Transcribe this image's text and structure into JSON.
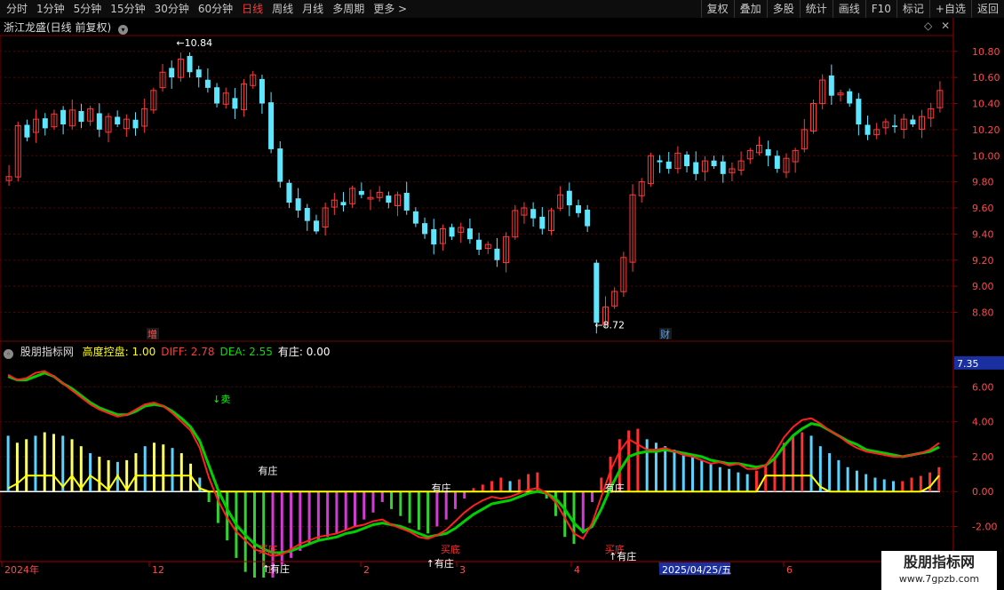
{
  "toolbar": {
    "periods": [
      "分时",
      "1分钟",
      "5分钟",
      "15分钟",
      "30分钟",
      "60分钟",
      "日线",
      "周线",
      "月线",
      "多周期",
      "更多 >"
    ],
    "active_period": "日线",
    "buttons": [
      "复权",
      "叠加",
      "多股",
      "统计",
      "画线",
      "F10",
      "标记",
      "+自选",
      "返回"
    ]
  },
  "main_chart": {
    "title": "浙江龙盛(日线 前复权)",
    "y_ticks": [
      "10.80",
      "10.60",
      "10.40",
      "10.20",
      "10.00",
      "9.80",
      "9.60",
      "9.40",
      "9.20",
      "9.00",
      "8.80"
    ],
    "y_range": [
      8.64,
      10.88
    ],
    "high_label": "10.84",
    "low_label": "8.72",
    "event_marks": [
      {
        "text": "增",
        "color": "#ff5555"
      },
      {
        "text": "财",
        "color": "#4da3ff"
      }
    ],
    "colors": {
      "up": "#ff3b3b",
      "down": "#5ee6ff",
      "grid": "#5a0000"
    }
  },
  "indicator": {
    "name": "股朋指标网",
    "legend": [
      {
        "label": "高度控盘: 1.00",
        "color": "#ffff00"
      },
      {
        "label": "DIFF: 2.78",
        "color": "#ff3b3b"
      },
      {
        "label": "DEA: 2.55",
        "color": "#00e000"
      },
      {
        "label": "有庄: 0.00",
        "color": "#ffffff"
      }
    ],
    "y_ticks": [
      "6.00",
      "4.00",
      "2.00",
      "0.00",
      "-2.00"
    ],
    "current_value": "7.35",
    "y_range": [
      -3.4,
      7.6
    ],
    "annotations": {
      "sell": "↓卖",
      "buy_bottom": "买底",
      "zhuang": "有庄",
      "zhuang_up": "↑有庄"
    }
  },
  "time_axis": {
    "labels": [
      "2024年",
      "12",
      "1",
      "2",
      "3",
      "4",
      "2025/04/25/五",
      "6"
    ],
    "highlight": "2025/04/25/五"
  },
  "watermark": {
    "line1": "股朋指标网",
    "line2": "www.7gpzb.com"
  },
  "chart_data": {
    "type": "candlestick",
    "title": "浙江龙盛(日线 前复权)",
    "ylim": [
      8.64,
      10.88
    ],
    "price_path": [
      9.84,
      10.23,
      10.14,
      10.28,
      10.21,
      10.32,
      10.24,
      10.35,
      10.26,
      10.36,
      10.2,
      10.3,
      10.24,
      10.28,
      10.21,
      10.36,
      10.5,
      10.64,
      10.6,
      10.74,
      10.64,
      10.6,
      10.52,
      10.4,
      10.48,
      10.36,
      10.55,
      10.62,
      10.4,
      10.05,
      9.8,
      9.64,
      9.58,
      9.5,
      9.42,
      9.6,
      9.66,
      9.62,
      9.75,
      9.7,
      9.68,
      9.72,
      9.64,
      9.7,
      9.58,
      9.48,
      9.4,
      9.32,
      9.44,
      9.38,
      9.45,
      9.36,
      9.28,
      9.32,
      9.2,
      9.38,
      9.58,
      9.6,
      9.52,
      9.44,
      9.58,
      9.7,
      9.62,
      9.56,
      9.46,
      8.72,
      8.84,
      8.96,
      9.22,
      9.7,
      9.8,
      10.0,
      9.95,
      9.9,
      10.02,
      9.92,
      9.86,
      9.96,
      9.92,
      9.86,
      9.9,
      9.96,
      10.04,
      10.08,
      10.0,
      9.9,
      9.98,
      10.04,
      10.2,
      10.4,
      10.58,
      10.46,
      10.48,
      10.4,
      10.24,
      10.16,
      10.2,
      10.26,
      10.22,
      10.28,
      10.24,
      10.3,
      10.36,
      10.5
    ],
    "high": 10.84,
    "low": 8.72,
    "indicator": {
      "diff": [
        6.7,
        6.4,
        6.5,
        6.8,
        6.9,
        6.6,
        6.2,
        5.8,
        5.4,
        5.0,
        4.7,
        4.5,
        4.3,
        4.4,
        4.7,
        5.0,
        5.1,
        4.9,
        4.5,
        4.0,
        3.5,
        2.5,
        0.8,
        -0.5,
        -1.5,
        -2.3,
        -2.8,
        -3.3,
        -3.5,
        -3.7,
        -3.6,
        -3.3,
        -3.0,
        -2.8,
        -2.6,
        -2.5,
        -2.4,
        -2.2,
        -2.0,
        -1.9,
        -1.7,
        -1.6,
        -1.9,
        -2.1,
        -2.3,
        -2.6,
        -2.7,
        -2.5,
        -2.2,
        -1.7,
        -1.2,
        -0.8,
        -0.5,
        -0.3,
        -0.4,
        -0.3,
        -0.1,
        0.1,
        0.2,
        -0.1,
        -0.6,
        -1.5,
        -2.4,
        -2.7,
        -1.8,
        -0.3,
        1.2,
        2.3,
        3.0,
        2.7,
        2.4,
        2.4,
        2.5,
        2.3,
        2.1,
        2.0,
        1.8,
        1.6,
        1.7,
        1.5,
        1.6,
        1.3,
        1.3,
        1.5,
        2.2,
        3.1,
        3.7,
        4.1,
        4.2,
        3.9,
        3.5,
        3.2,
        2.8,
        2.5,
        2.3,
        2.2,
        2.1,
        2.0,
        2.0,
        2.1,
        2.2,
        2.4,
        2.78
      ],
      "dea": [
        6.6,
        6.4,
        6.4,
        6.6,
        6.8,
        6.6,
        6.2,
        5.9,
        5.5,
        5.1,
        4.8,
        4.6,
        4.4,
        4.4,
        4.6,
        4.9,
        5.0,
        4.9,
        4.6,
        4.2,
        3.7,
        2.9,
        1.5,
        0.1,
        -1.0,
        -1.9,
        -2.5,
        -3.0,
        -3.3,
        -3.5,
        -3.5,
        -3.4,
        -3.2,
        -3.0,
        -2.8,
        -2.7,
        -2.6,
        -2.4,
        -2.3,
        -2.1,
        -1.9,
        -1.8,
        -1.9,
        -2.0,
        -2.2,
        -2.4,
        -2.6,
        -2.5,
        -2.4,
        -2.1,
        -1.7,
        -1.3,
        -1.0,
        -0.7,
        -0.6,
        -0.5,
        -0.3,
        -0.1,
        0.0,
        -0.1,
        -0.4,
        -1.0,
        -1.8,
        -2.3,
        -2.0,
        -1.0,
        0.2,
        1.2,
        2.0,
        2.2,
        2.3,
        2.3,
        2.4,
        2.3,
        2.2,
        2.1,
        2.0,
        1.8,
        1.7,
        1.6,
        1.6,
        1.5,
        1.4,
        1.5,
        1.9,
        2.6,
        3.2,
        3.6,
        3.9,
        3.8,
        3.5,
        3.2,
        2.9,
        2.7,
        2.4,
        2.3,
        2.2,
        2.1,
        2.0,
        2.1,
        2.2,
        2.3,
        2.55
      ],
      "histogram": [
        3.2,
        2.8,
        3.0,
        3.2,
        3.4,
        3.3,
        3.2,
        3.0,
        2.6,
        2.2,
        2.0,
        1.8,
        1.7,
        1.8,
        2.2,
        2.6,
        2.8,
        2.7,
        2.5,
        2.2,
        1.6,
        0.8,
        -0.6,
        -1.8,
        -2.8,
        -3.8,
        -4.6,
        -5.2,
        -5.4,
        -5.0,
        -4.2,
        -3.8,
        -3.4,
        -3.0,
        -2.8,
        -2.6,
        -2.4,
        -2.2,
        -2.0,
        -1.6,
        -1.2,
        -0.6,
        -1.0,
        -1.4,
        -1.8,
        -2.2,
        -2.4,
        -2.0,
        -1.6,
        -1.0,
        -0.4,
        0.2,
        0.4,
        0.6,
        0.8,
        0.6,
        0.7,
        1.0,
        1.1,
        -0.4,
        -1.4,
        -2.6,
        -3.0,
        -2.4,
        -0.6,
        0.8,
        2.0,
        3.0,
        3.5,
        3.6,
        3.0,
        2.8,
        2.6,
        2.4,
        2.2,
        2.0,
        1.8,
        1.6,
        1.4,
        1.3,
        1.1,
        1.0,
        1.2,
        1.5,
        2.0,
        2.8,
        3.2,
        3.4,
        3.2,
        2.6,
        2.2,
        1.8,
        1.4,
        1.2,
        1.0,
        0.8,
        0.7,
        0.6,
        0.6,
        0.8,
        0.9,
        1.1,
        1.4
      ],
      "control": [
        0.2,
        0.5,
        1.0,
        1.0,
        1.0,
        1.0,
        0.3,
        1.0,
        0.2,
        1.0,
        0.6,
        0.1,
        1.0,
        0.1,
        1.0,
        1.0,
        1.0,
        1.0,
        1.0,
        1.0,
        1.0,
        0.2,
        0,
        0,
        0,
        0,
        0,
        0,
        0,
        0,
        0,
        0,
        0,
        0,
        0,
        0,
        0,
        0,
        0,
        0,
        0,
        0,
        0,
        0,
        0,
        0,
        0,
        0,
        0,
        0,
        0,
        0,
        0,
        0,
        0,
        0,
        0,
        0,
        0,
        0,
        0,
        0,
        0,
        0,
        0,
        0,
        0,
        0,
        0,
        0,
        0,
        0,
        0,
        0,
        0,
        0,
        0,
        0,
        0,
        0,
        0,
        0,
        0,
        1.0,
        1.0,
        1.0,
        1.0,
        1.0,
        1.0,
        0.3,
        0,
        0,
        0,
        0,
        0,
        0,
        0,
        0,
        0,
        0,
        0,
        0.3,
        1.0,
        1.0
      ]
    }
  }
}
